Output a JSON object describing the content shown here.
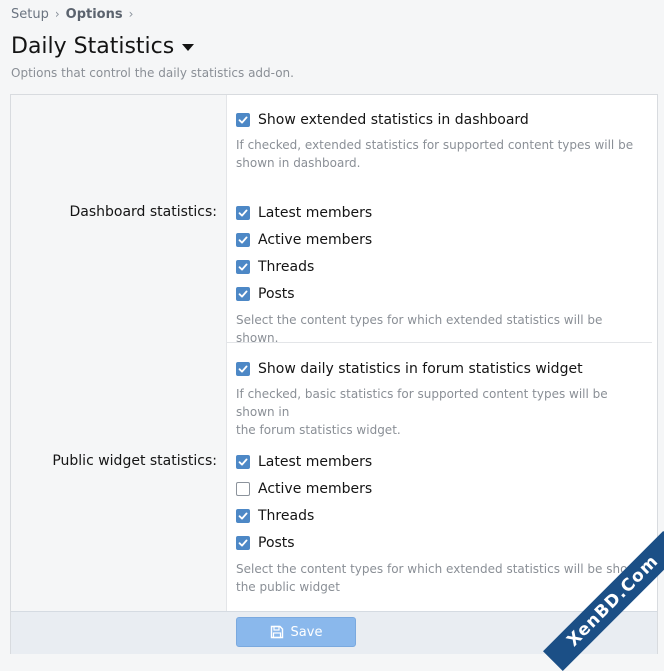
{
  "breadcrumb": {
    "items": [
      "Setup",
      "Options"
    ]
  },
  "page": {
    "title": "Daily Statistics",
    "description": "Options that control the daily statistics add-on."
  },
  "sections": {
    "dashboard": {
      "label": "Dashboard statistics:",
      "main_option": {
        "label": "Show extended statistics in dashboard",
        "checked": true
      },
      "main_hint": [
        "If checked, extended statistics for supported content types will be",
        "shown in dashboard."
      ],
      "types": [
        {
          "label": "Latest members",
          "checked": true
        },
        {
          "label": "Active members",
          "checked": true
        },
        {
          "label": "Threads",
          "checked": true
        },
        {
          "label": "Posts",
          "checked": true
        }
      ],
      "types_hint": "Select the content types for which extended statistics will be shown."
    },
    "public_widget": {
      "label": "Public widget statistics:",
      "main_option": {
        "label": "Show daily statistics in forum statistics widget",
        "checked": true
      },
      "main_hint": [
        "If checked, basic statistics for supported content types will be shown in",
        "the forum statistics widget."
      ],
      "types": [
        {
          "label": "Latest members",
          "checked": true
        },
        {
          "label": "Active members",
          "checked": false
        },
        {
          "label": "Threads",
          "checked": true
        },
        {
          "label": "Posts",
          "checked": true
        }
      ],
      "types_hint": [
        "Select the content types for which extended statistics will be shown",
        "the public widget"
      ]
    }
  },
  "footer": {
    "save_label": "Save"
  },
  "watermark": "XenBD.Com",
  "colors": {
    "accent": "#4d88c6",
    "save_button": "#8ab8ec"
  }
}
